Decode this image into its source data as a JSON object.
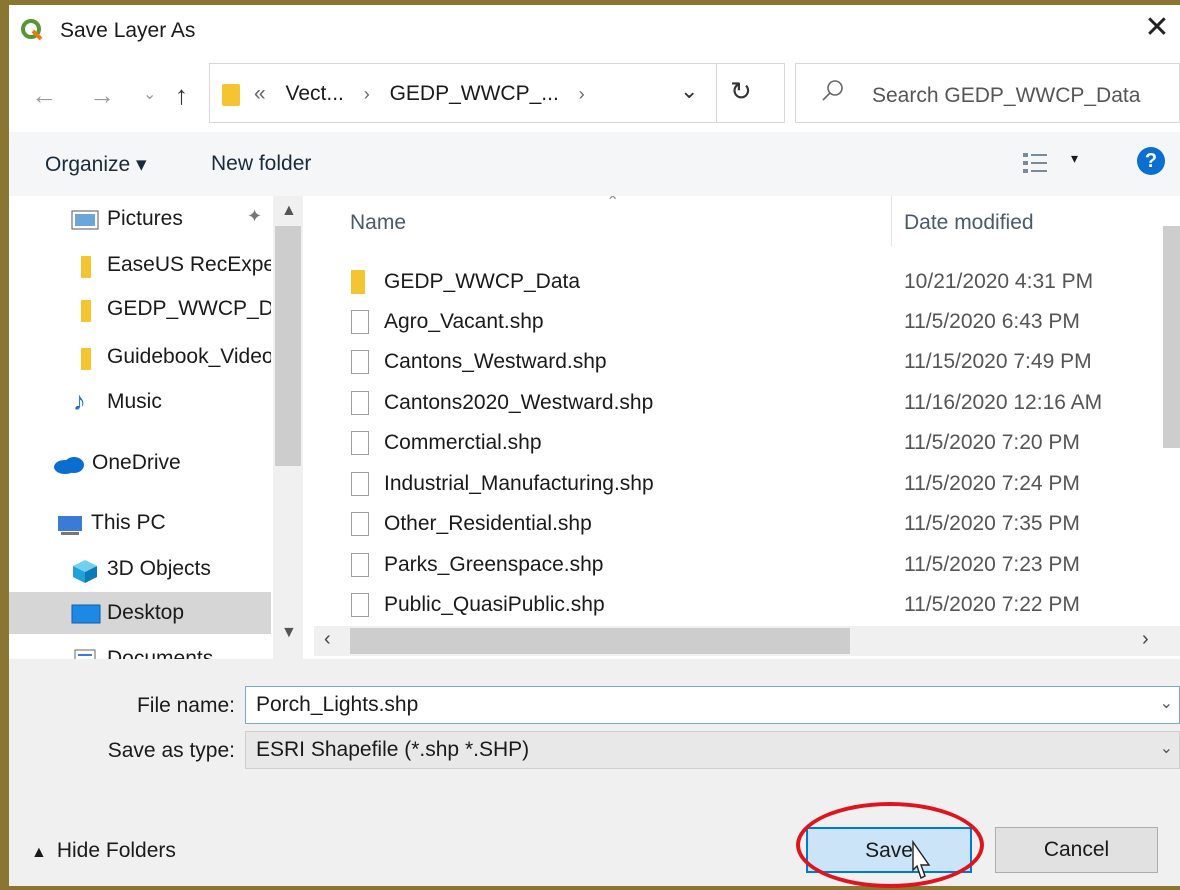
{
  "window": {
    "title": "Save Layer As",
    "close_label": "✕"
  },
  "nav": {
    "back": "←",
    "forward": "→",
    "recent": "⌄",
    "up": "↑"
  },
  "address": {
    "overflow": "«",
    "crumbs": [
      "Vect...",
      "GEDP_WWCP_..."
    ],
    "separator": "›",
    "dropdown": "⌄",
    "refresh": "↻"
  },
  "search": {
    "placeholder": "Search GEDP_WWCP_Data"
  },
  "toolbar": {
    "organize": "Organize ▾",
    "new_folder": "New folder",
    "view_dd": "▾",
    "help": "?"
  },
  "sidebar": {
    "items": [
      {
        "label": "Pictures",
        "icon": "pictures-icon",
        "pinned": true
      },
      {
        "label": "EaseUS RecExperts",
        "icon": "folder-icon"
      },
      {
        "label": "GEDP_WWCP_Data",
        "icon": "folder-icon"
      },
      {
        "label": "Guidebook_Videos",
        "icon": "folder-icon"
      },
      {
        "label": "Music",
        "icon": "music-icon"
      },
      {
        "label": "OneDrive",
        "icon": "onedrive-icon"
      },
      {
        "label": "This PC",
        "icon": "computer-icon"
      },
      {
        "label": "3D Objects",
        "icon": "cube-icon"
      },
      {
        "label": "Desktop",
        "icon": "desktop-icon",
        "selected": true
      },
      {
        "label": "Documents",
        "icon": "documents-icon"
      }
    ]
  },
  "files": {
    "columns": {
      "name": "Name",
      "date": "Date modified"
    },
    "rows": [
      {
        "name": "GEDP_WWCP_Data",
        "date": "10/21/2020 4:31 PM",
        "type": "folder"
      },
      {
        "name": "Agro_Vacant.shp",
        "date": "11/5/2020 6:43 PM",
        "type": "file"
      },
      {
        "name": "Cantons_Westward.shp",
        "date": "11/15/2020 7:49 PM",
        "type": "file"
      },
      {
        "name": "Cantons2020_Westward.shp",
        "date": "11/16/2020 12:16 AM",
        "type": "file"
      },
      {
        "name": "Commerctial.shp",
        "date": "11/5/2020 7:20 PM",
        "type": "file"
      },
      {
        "name": "Industrial_Manufacturing.shp",
        "date": "11/5/2020 7:24 PM",
        "type": "file"
      },
      {
        "name": "Other_Residential.shp",
        "date": "11/5/2020 7:35 PM",
        "type": "file"
      },
      {
        "name": "Parks_Greenspace.shp",
        "date": "11/5/2020 7:23 PM",
        "type": "file"
      },
      {
        "name": "Public_QuasiPublic.shp",
        "date": "11/5/2020 7:22 PM",
        "type": "file"
      }
    ]
  },
  "form": {
    "file_name_label": "File name:",
    "file_name_value": "Porch_Lights.shp",
    "type_label": "Save as type:",
    "type_value": "ESRI Shapefile (*.shp *.SHP)"
  },
  "footer": {
    "hide_folders": "Hide Folders",
    "save": "Save",
    "cancel": "Cancel"
  },
  "colors": {
    "accent": "#0078d7",
    "highlight_ring": "#e0141e",
    "folder": "#f4c431"
  }
}
